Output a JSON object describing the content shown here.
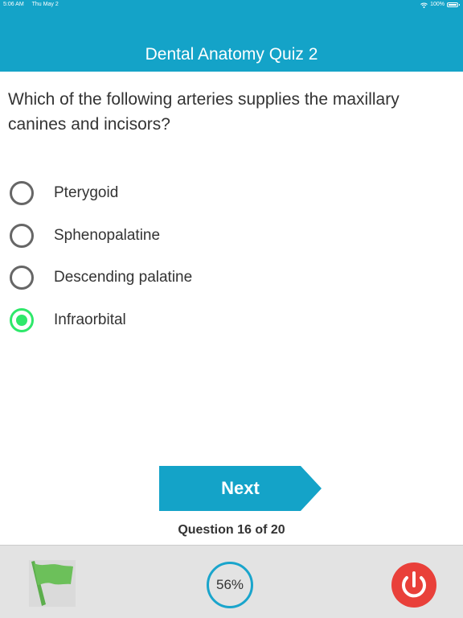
{
  "status_bar": {
    "time": "5:06 AM",
    "date": "Thu May 2",
    "battery": "100%",
    "icons": [
      "wifi-icon",
      "battery-icon"
    ]
  },
  "header": {
    "title": "Dental Anatomy Quiz 2"
  },
  "question": {
    "text": "Which of the following arteries supplies the maxillary canines and incisors?"
  },
  "options": [
    {
      "label": "Pterygoid",
      "selected": false
    },
    {
      "label": "Sphenopalatine",
      "selected": false
    },
    {
      "label": "Descending palatine",
      "selected": false
    },
    {
      "label": "Infraorbital",
      "selected": true
    }
  ],
  "next_button": {
    "label": "Next"
  },
  "counter": {
    "text": "Question 16 of 20"
  },
  "bottom_bar": {
    "flag_icon": "flag-icon",
    "progress": "56%",
    "power_icon": "power-icon"
  },
  "colors": {
    "header": "#14a3c8",
    "next_button": "#14a3c8",
    "selected": "#2ee86a",
    "flag": "#66bb55",
    "power": "#e9403a"
  }
}
